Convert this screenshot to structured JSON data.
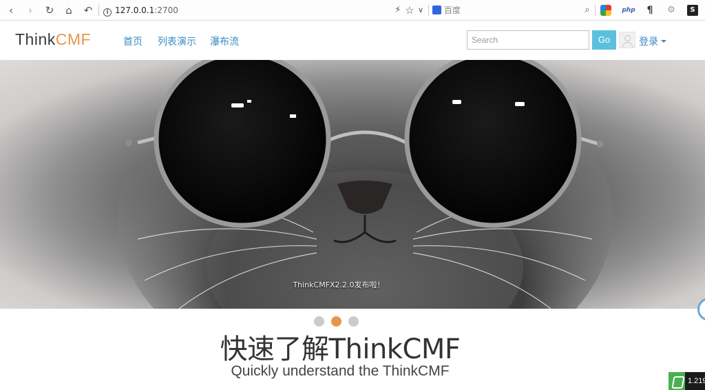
{
  "browser": {
    "url_host": "127.0.0.1",
    "url_port": ":2700",
    "search_engine_placeholder": "百度",
    "icons": [
      "back-icon",
      "forward-icon",
      "reload-icon",
      "home-icon",
      "undo-icon",
      "info-icon",
      "lightning-icon",
      "star-icon",
      "search-icon",
      "ext-colorful-icon",
      "ext-php-icon",
      "ext-pilcrow-icon",
      "ext-gear-icon",
      "ext-s-icon"
    ],
    "ext_php_label": "php",
    "ext_pilcrow_label": "¶",
    "ext_s_label": "S"
  },
  "header": {
    "logo_part1": "Think",
    "logo_part2": "CMF",
    "nav": [
      {
        "label": "首页"
      },
      {
        "label": "列表演示"
      },
      {
        "label": "瀑布流"
      }
    ],
    "search": {
      "placeholder": "Search",
      "value": ""
    },
    "go_label": "Go",
    "login_label": "登录"
  },
  "hero": {
    "caption": "ThinkCMFX2.2.0发布啦！",
    "slide_count": 3,
    "active_slide": 1
  },
  "content": {
    "headline": "快速了解ThinkCMF",
    "subline": "Quickly understand the ThinkCMF"
  },
  "taskbar": {
    "badge_text": "1.219"
  },
  "colors": {
    "brand_orange": "#e8964a",
    "link_blue": "#3a8bc4",
    "go_button": "#5bc0de"
  }
}
